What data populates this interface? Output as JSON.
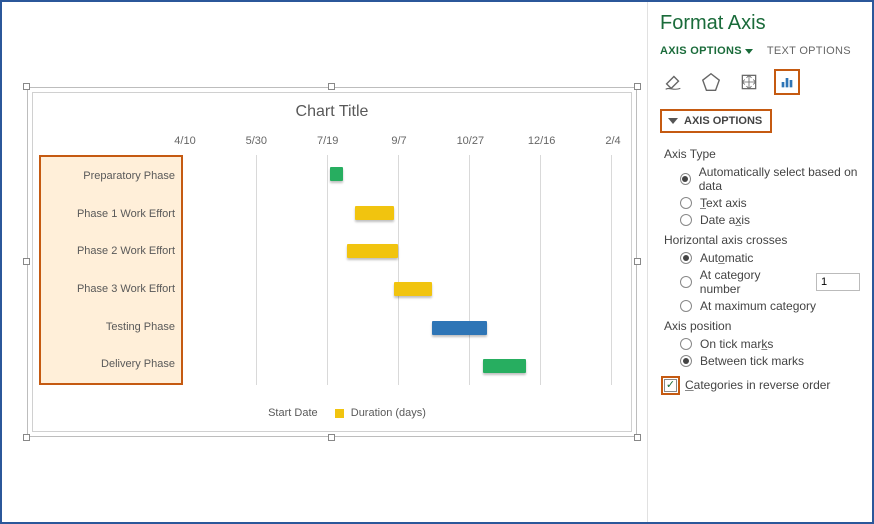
{
  "chart_data": {
    "type": "bar",
    "orientation": "horizontal",
    "title": "Chart Title",
    "x_ticks": [
      "4/10",
      "5/30",
      "7/19",
      "9/7",
      "10/27",
      "12/16",
      "2/4"
    ],
    "categories": [
      "Preparatory Phase",
      "Phase 1 Work Effort",
      "Phase 2 Work Effort",
      "Phase 3 Work Effort",
      "Testing Phase",
      "Delivery Phase"
    ],
    "bars": [
      {
        "label": "Preparatory Phase",
        "left_pct": 34,
        "width_pct": 3,
        "color": "green"
      },
      {
        "label": "Phase 1 Work Effort",
        "left_pct": 40,
        "width_pct": 9,
        "color": "yellow"
      },
      {
        "label": "Phase 2 Work Effort",
        "left_pct": 38,
        "width_pct": 12,
        "color": "yellow"
      },
      {
        "label": "Phase 3 Work Effort",
        "left_pct": 49,
        "width_pct": 9,
        "color": "yellow"
      },
      {
        "label": "Testing Phase",
        "left_pct": 58,
        "width_pct": 13,
        "color": "blue"
      },
      {
        "label": "Delivery Phase",
        "left_pct": 70,
        "width_pct": 10,
        "color": "green"
      }
    ],
    "legend": [
      {
        "label": "Start Date",
        "swatch": "none"
      },
      {
        "label": "Duration (days)",
        "swatch": "yellow"
      }
    ]
  },
  "pane": {
    "title": "Format Axis",
    "tabs": {
      "axis_options": "AXIS OPTIONS",
      "text_options": "TEXT OPTIONS"
    },
    "section": "AXIS OPTIONS",
    "axis_type": {
      "label": "Axis Type",
      "opts": {
        "auto": "Automatically select based on data",
        "text": "Text axis",
        "date": "Date axis"
      },
      "selected": "auto"
    },
    "crosses": {
      "label": "Horizontal axis crosses",
      "opts": {
        "auto": "Automatic",
        "at_cat": "At category number",
        "at_max": "At maximum category"
      },
      "selected": "auto",
      "at_cat_value": "1"
    },
    "position": {
      "label": "Axis position",
      "opts": {
        "on": "On tick marks",
        "between": "Between tick marks"
      },
      "selected": "between"
    },
    "reverse": {
      "label": "Categories in reverse order",
      "checked": true
    }
  }
}
